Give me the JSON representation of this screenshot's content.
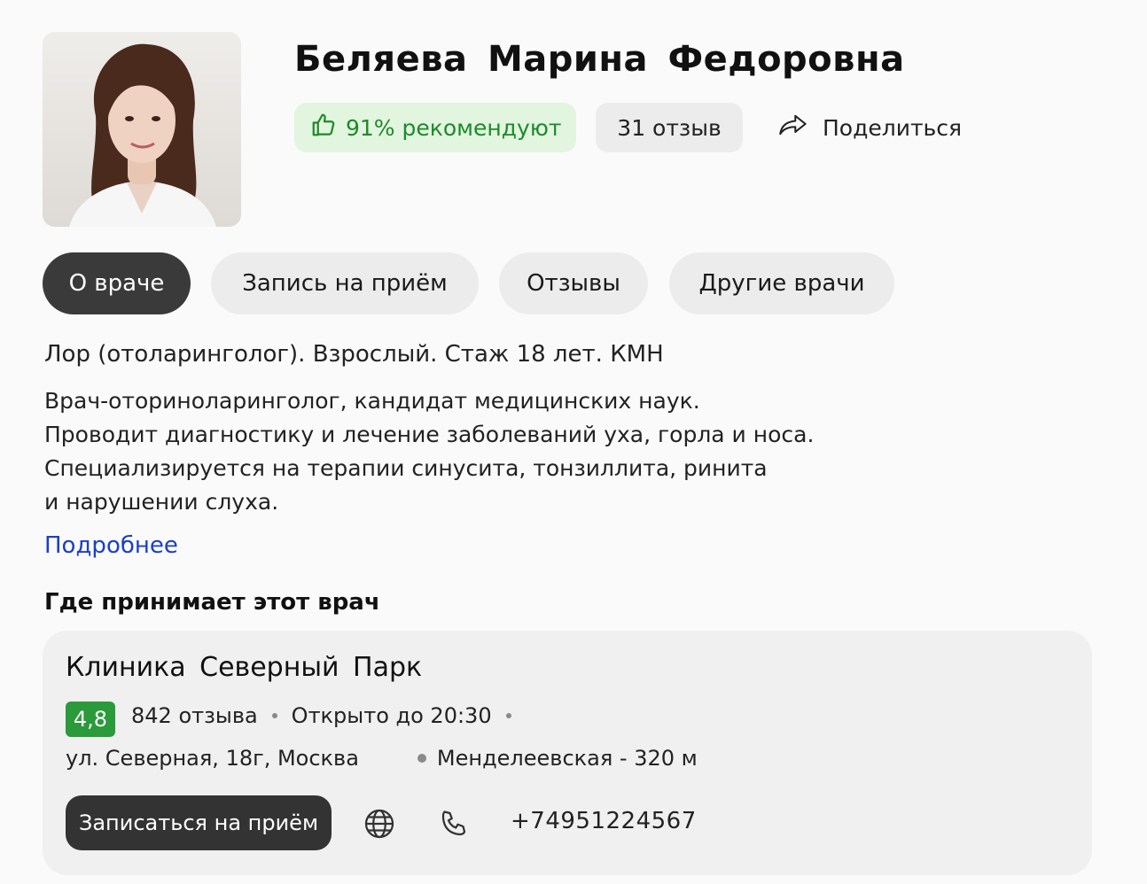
{
  "doctor": {
    "name": "Беляева  Марина  Федоровна",
    "recommend": "91% рекомендуют",
    "reviews": "31 отзыв",
    "share": "Поделиться"
  },
  "tabs": [
    {
      "label": "О враче",
      "active": true
    },
    {
      "label": "Запись на приём",
      "active": false
    },
    {
      "label": "Отзывы",
      "active": false
    },
    {
      "label": "Другие врачи",
      "active": false
    }
  ],
  "about": {
    "specialty": "Лор (отоларинголог). Взрослый. Стаж 18 лет. КМН",
    "description": [
      "Врач-оториноларинголог, кандидат медицинских наук.",
      "Проводит диагностику и лечение заболеваний уха, горла и носа.",
      "Специализируется на терапии синусита, тонзиллита, ринита",
      "и нарушении слуха."
    ],
    "more_link": "Подробнее"
  },
  "where_title": "Где принимает этот врач",
  "clinic": {
    "name": "Клиника  Северный Парк",
    "rating": "4,8",
    "reviews": "842 отзыва",
    "hours": "Открыто до 20:30",
    "address": "ул. Северная, 18г, Москва",
    "metro": "Менделеевская - 320 м",
    "book_label": "Записаться на приём",
    "phone": "+74951224567"
  },
  "colors": {
    "accent_green": "#1f8a2a",
    "rating_green": "#2a9a3a",
    "link_blue": "#1a3fc7",
    "active_tab": "#3a3a3a"
  },
  "icons": [
    "thumbs-up-icon",
    "share-icon",
    "globe-icon",
    "phone-icon"
  ]
}
